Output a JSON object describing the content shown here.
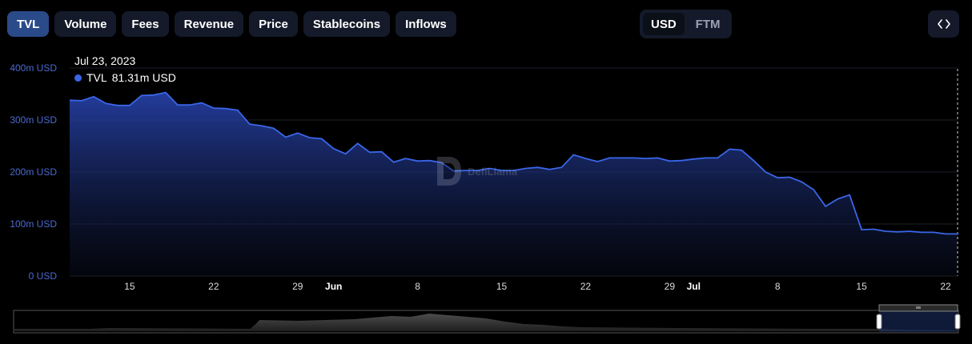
{
  "tabs": [
    {
      "label": "TVL",
      "active": true
    },
    {
      "label": "Volume",
      "active": false
    },
    {
      "label": "Fees",
      "active": false
    },
    {
      "label": "Revenue",
      "active": false
    },
    {
      "label": "Price",
      "active": false
    },
    {
      "label": "Stablecoins",
      "active": false
    },
    {
      "label": "Inflows",
      "active": false
    }
  ],
  "currency": {
    "options": [
      "USD",
      "FTM"
    ],
    "selected": "USD"
  },
  "embed_icon": "code-icon",
  "tooltip": {
    "date": "Jul 23, 2023",
    "series": "TVL",
    "value": "81.31m USD"
  },
  "watermark": "DefiLlama",
  "colors": {
    "line": "#3a66e8",
    "tab_active": "#2a4a8a",
    "tab_bg": "#141a2a",
    "axis_text": "#4a6ad0"
  },
  "chart_data": {
    "type": "area",
    "series": [
      {
        "name": "TVL"
      }
    ],
    "y_unit": "USD",
    "ylim": [
      0,
      400
    ],
    "y_ticks": [
      "0 USD",
      "100m USD",
      "200m USD",
      "300m USD",
      "400m USD"
    ],
    "x_ticks": [
      "15",
      "22",
      "29",
      "Jun",
      "8",
      "15",
      "22",
      "29",
      "Jul",
      "8",
      "15",
      "22"
    ],
    "x_start": "2023-05-10",
    "x_end": "2023-07-23",
    "values_m_usd": [
      338,
      337,
      345,
      332,
      328,
      328,
      347,
      348,
      353,
      329,
      329,
      333,
      323,
      322,
      319,
      292,
      289,
      284,
      267,
      275,
      266,
      264,
      245,
      235,
      255,
      238,
      239,
      219,
      226,
      221,
      222,
      218,
      202,
      203,
      203,
      207,
      203,
      203,
      207,
      209,
      205,
      209,
      233,
      226,
      220,
      227,
      227,
      227,
      226,
      227,
      221,
      222,
      225,
      227,
      227,
      244,
      242,
      222,
      200,
      189,
      190,
      181,
      166,
      134,
      148,
      156,
      89,
      90,
      86,
      85,
      86,
      84,
      84,
      81,
      81
    ],
    "brush": {
      "range_start": "2023-05-10",
      "range_end": "2023-07-23"
    }
  }
}
